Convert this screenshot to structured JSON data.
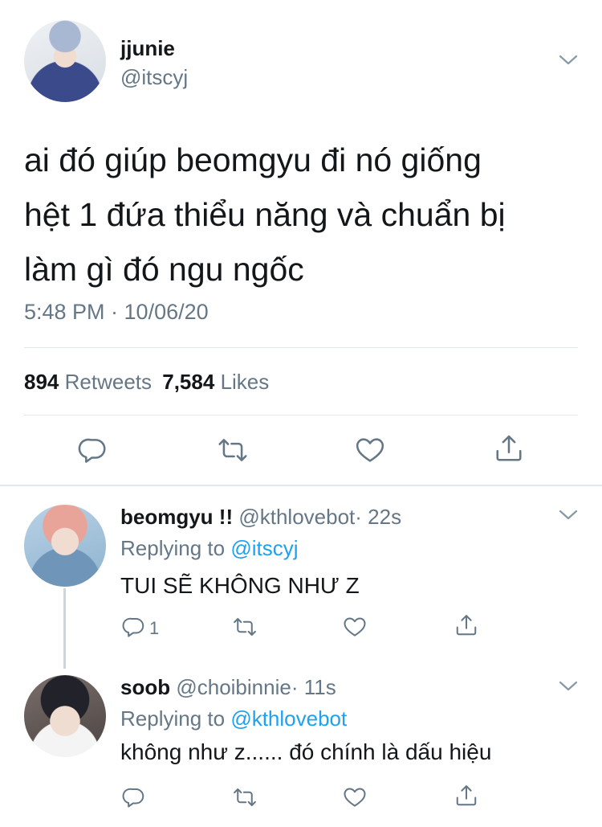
{
  "main_tweet": {
    "display_name": "jjunie",
    "handle": "@itscyj",
    "text_lines": [
      "ai đó giúp beomgyu đi nó giống",
      "hệt 1 đứa thiểu năng và chuẩn bị",
      "làm gì đó ngu ngốc"
    ],
    "timestamp": "5:48 PM · 10/06/20",
    "retweet_count": "894",
    "retweets_label": "Retweets",
    "like_count": "7,584",
    "likes_label": "Likes"
  },
  "replies": [
    {
      "display_name": "beomgyu !!",
      "handle": "@kthlovebot",
      "time": "· 22s",
      "replying_prefix": "Replying to",
      "replying_to": "@itscyj",
      "text": "TUI SẼ KHÔNG NHƯ Z",
      "reply_count": "1"
    },
    {
      "display_name": "soob",
      "handle": "@choibinnie",
      "time": "· 11s",
      "replying_prefix": "Replying to",
      "replying_to": "@kthlovebot",
      "text": "không như z...... đó chính là dấu hiệu",
      "reply_count": ""
    }
  ],
  "icons": [
    "chevron-down-icon",
    "reply-icon",
    "retweet-icon",
    "like-icon",
    "share-icon"
  ],
  "colors": {
    "accent": "#1da1f2",
    "muted": "#657786",
    "text": "#14171a",
    "divider": "#e1e8ed"
  }
}
